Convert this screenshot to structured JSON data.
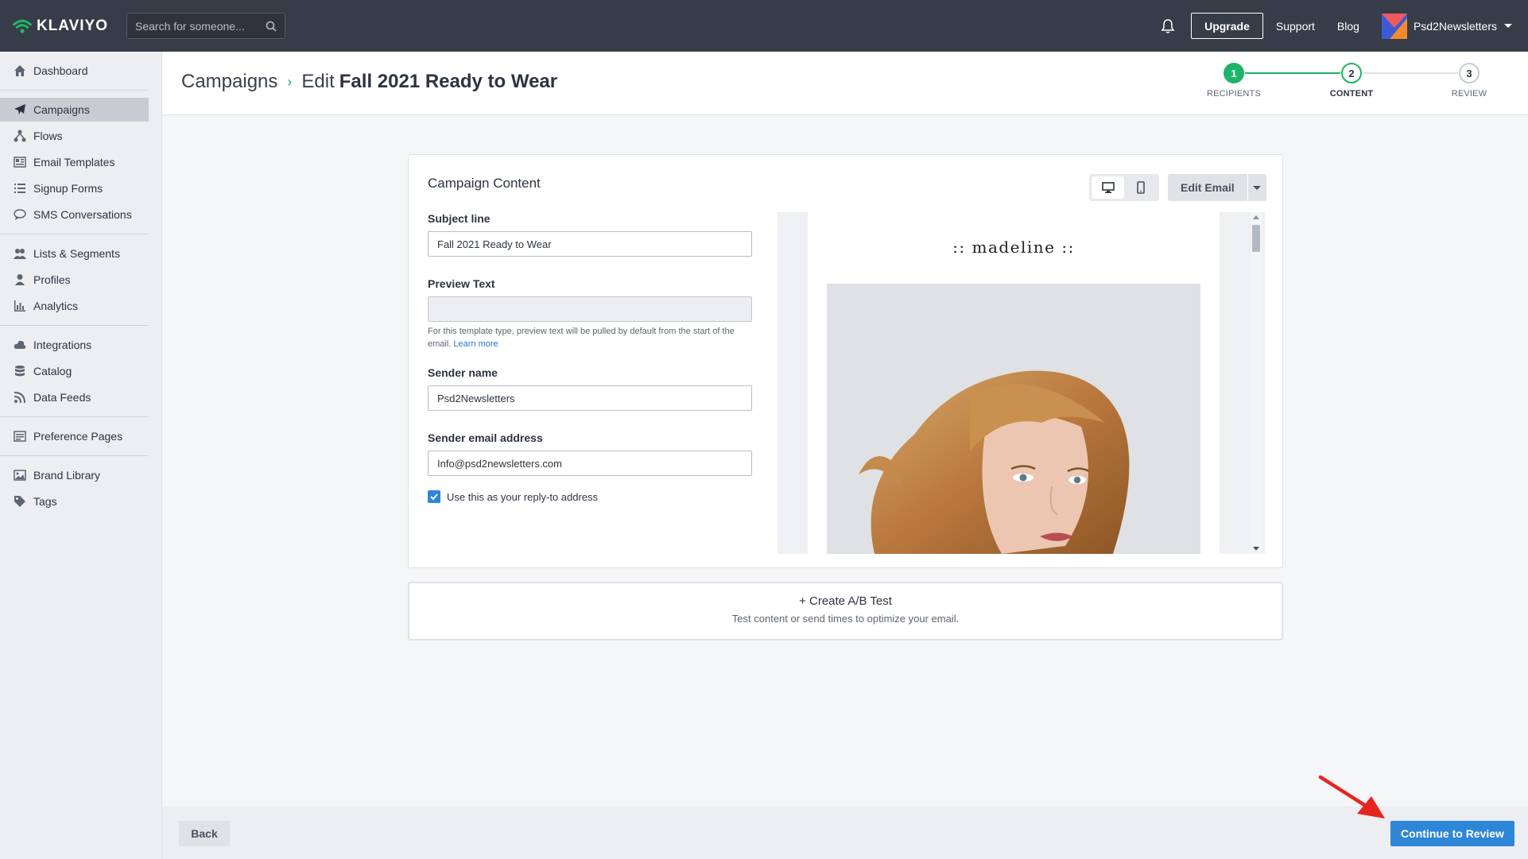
{
  "topbar": {
    "brand": "KLAVIYO",
    "search_placeholder": "Search for someone...",
    "upgrade_label": "Upgrade",
    "support_label": "Support",
    "blog_label": "Blog",
    "account_name": "Psd2Newsletters"
  },
  "sidebar": {
    "groups": [
      [
        {
          "label": "Dashboard",
          "icon": "home-icon"
        }
      ],
      [
        {
          "label": "Campaigns",
          "icon": "paper-plane-icon",
          "active": true
        },
        {
          "label": "Flows",
          "icon": "flow-icon"
        },
        {
          "label": "Email Templates",
          "icon": "template-icon"
        },
        {
          "label": "Signup Forms",
          "icon": "list-icon"
        },
        {
          "label": "SMS Conversations",
          "icon": "chat-icon"
        }
      ],
      [
        {
          "label": "Lists & Segments",
          "icon": "users-icon"
        },
        {
          "label": "Profiles",
          "icon": "user-icon"
        },
        {
          "label": "Analytics",
          "icon": "bar-chart-icon"
        }
      ],
      [
        {
          "label": "Integrations",
          "icon": "cloud-icon"
        },
        {
          "label": "Catalog",
          "icon": "database-icon"
        },
        {
          "label": "Data Feeds",
          "icon": "rss-icon"
        }
      ],
      [
        {
          "label": "Preference Pages",
          "icon": "preference-icon"
        }
      ],
      [
        {
          "label": "Brand Library",
          "icon": "image-icon"
        },
        {
          "label": "Tags",
          "icon": "tag-icon"
        }
      ]
    ]
  },
  "header": {
    "crumb_root": "Campaigns",
    "crumb_separator": "›",
    "crumb_prefix": "Edit",
    "crumb_title": "Fall 2021 Ready to Wear",
    "steps": [
      {
        "number": "1",
        "label": "RECIPIENTS"
      },
      {
        "number": "2",
        "label": "CONTENT"
      },
      {
        "number": "3",
        "label": "REVIEW"
      }
    ]
  },
  "content": {
    "card_title": "Campaign Content",
    "edit_email_label": "Edit Email",
    "subject_label": "Subject line",
    "subject_value": "Fall 2021 Ready to Wear",
    "preview_text_label": "Preview Text",
    "preview_text_value": "",
    "preview_help": "For this template type, preview text will be pulled by default from the start of the email.",
    "learn_more": "Learn more",
    "sender_name_label": "Sender name",
    "sender_name_value": "Psd2Newsletters",
    "sender_email_label": "Sender email address",
    "sender_email_value": "Info@psd2newsletters.com",
    "reply_to_label": "Use this as your reply-to address",
    "reply_to_checked": true
  },
  "email_preview": {
    "brand_heading": ":: madeline ::"
  },
  "ab_test": {
    "title": "+ Create A/B Test",
    "subtitle": "Test content or send times to optimize your email."
  },
  "footer": {
    "back_label": "Back",
    "continue_label": "Continue to Review"
  },
  "colors": {
    "topbar": "#373d48",
    "accent_green": "#1db469",
    "primary_blue": "#2e86d6",
    "annotation_red": "#e8231f"
  }
}
